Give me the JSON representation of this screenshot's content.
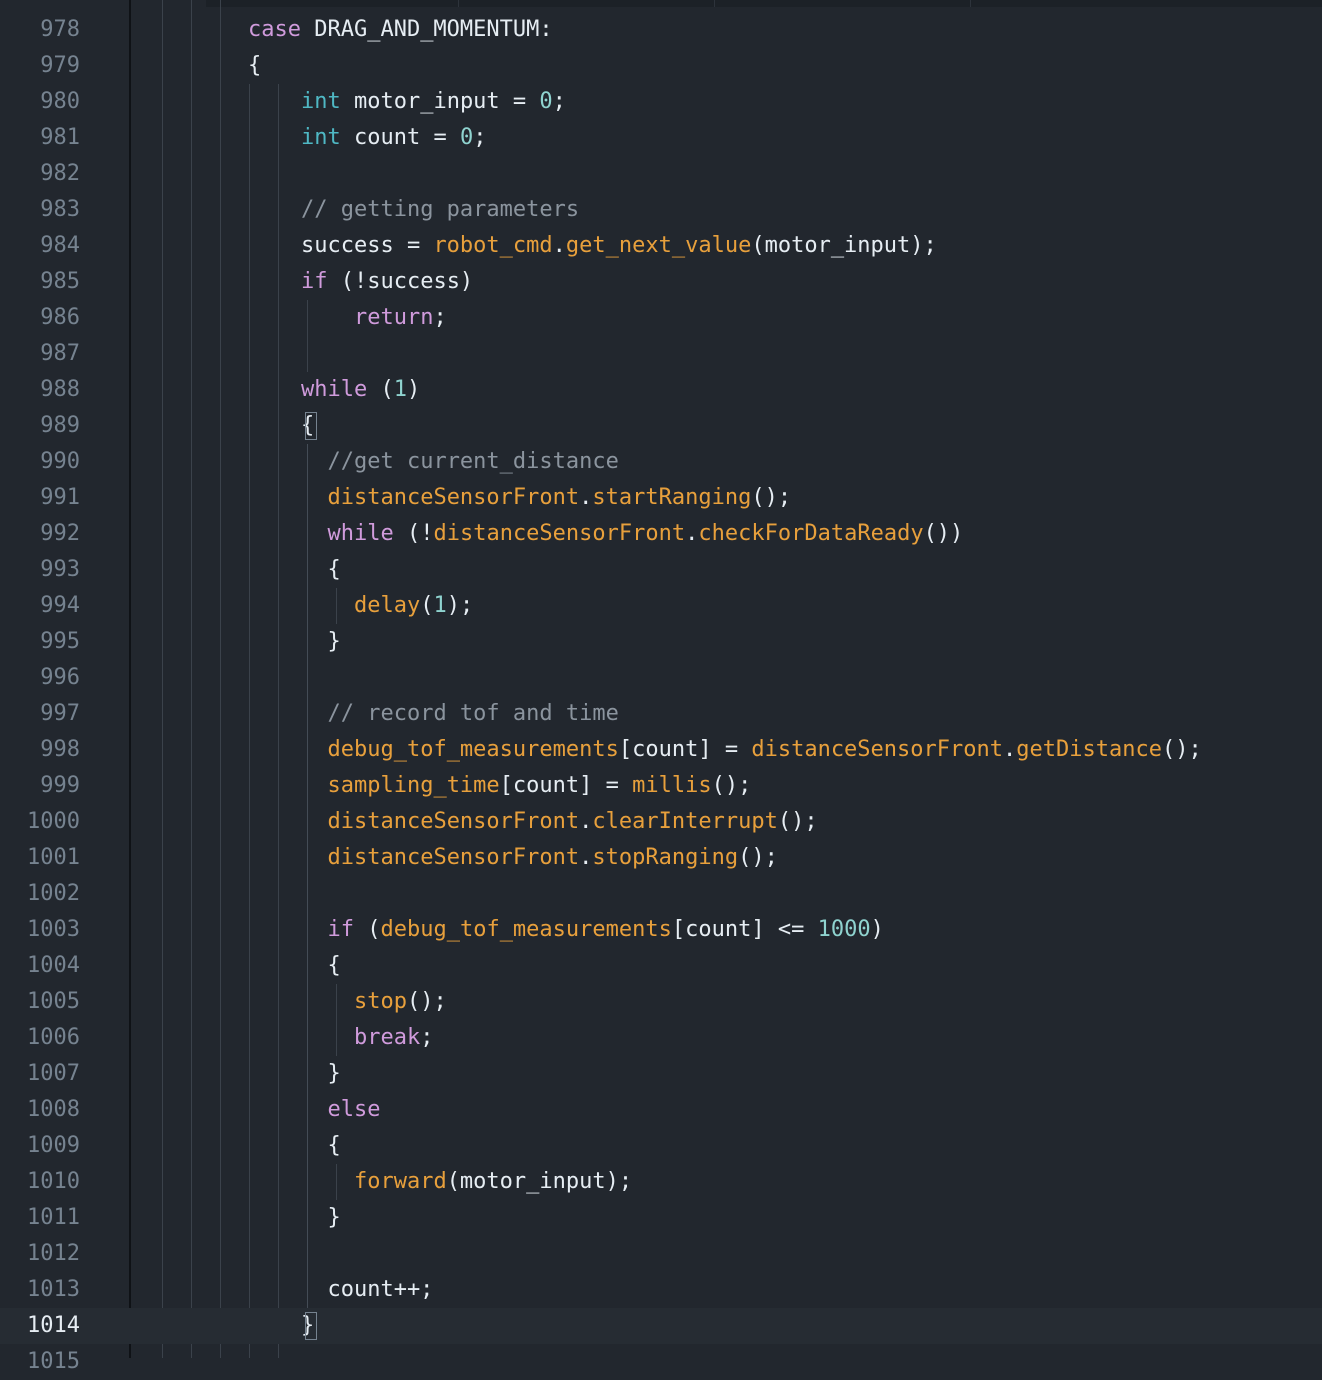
{
  "editor": {
    "current_line": "1014",
    "lines": [
      {
        "n": "978",
        "tokens": [
          [
            "kw",
            "case"
          ],
          [
            "pl",
            " DRAG_AND_MOMENTUM:"
          ]
        ]
      },
      {
        "n": "979",
        "tokens": [
          [
            "pl",
            "{"
          ]
        ]
      },
      {
        "n": "980",
        "tokens": [
          [
            "pl",
            "    "
          ],
          [
            "ty",
            "int"
          ],
          [
            "pl",
            " motor_input = "
          ],
          [
            "num",
            "0"
          ],
          [
            "pl",
            ";"
          ]
        ]
      },
      {
        "n": "981",
        "tokens": [
          [
            "pl",
            "    "
          ],
          [
            "ty",
            "int"
          ],
          [
            "pl",
            " count = "
          ],
          [
            "num",
            "0"
          ],
          [
            "pl",
            ";"
          ]
        ]
      },
      {
        "n": "982",
        "tokens": []
      },
      {
        "n": "983",
        "tokens": [
          [
            "pl",
            "    "
          ],
          [
            "cm",
            "// getting parameters"
          ]
        ]
      },
      {
        "n": "984",
        "tokens": [
          [
            "pl",
            "    success = "
          ],
          [
            "fn",
            "robot_cmd"
          ],
          [
            "pl",
            "."
          ],
          [
            "fn",
            "get_next_value"
          ],
          [
            "pl",
            "(motor_input);"
          ]
        ]
      },
      {
        "n": "985",
        "tokens": [
          [
            "pl",
            "    "
          ],
          [
            "kw",
            "if"
          ],
          [
            "pl",
            " (!success)"
          ]
        ]
      },
      {
        "n": "986",
        "tokens": [
          [
            "pl",
            "        "
          ],
          [
            "kw",
            "return"
          ],
          [
            "pl",
            ";"
          ]
        ]
      },
      {
        "n": "987",
        "tokens": []
      },
      {
        "n": "988",
        "tokens": [
          [
            "pl",
            "    "
          ],
          [
            "kw",
            "while"
          ],
          [
            "pl",
            " ("
          ],
          [
            "num",
            "1"
          ],
          [
            "pl",
            ")"
          ]
        ]
      },
      {
        "n": "989",
        "tokens": [
          [
            "pl",
            "    {"
          ]
        ]
      },
      {
        "n": "990",
        "tokens": [
          [
            "pl",
            "      "
          ],
          [
            "cm",
            "//get current_distance"
          ]
        ]
      },
      {
        "n": "991",
        "tokens": [
          [
            "pl",
            "      "
          ],
          [
            "fn",
            "distanceSensorFront"
          ],
          [
            "pl",
            "."
          ],
          [
            "fn",
            "startRanging"
          ],
          [
            "pl",
            "();"
          ]
        ]
      },
      {
        "n": "992",
        "tokens": [
          [
            "pl",
            "      "
          ],
          [
            "kw",
            "while"
          ],
          [
            "pl",
            " (!"
          ],
          [
            "fn",
            "distanceSensorFront"
          ],
          [
            "pl",
            "."
          ],
          [
            "fn",
            "checkForDataReady"
          ],
          [
            "pl",
            "())"
          ]
        ]
      },
      {
        "n": "993",
        "tokens": [
          [
            "pl",
            "      {"
          ]
        ]
      },
      {
        "n": "994",
        "tokens": [
          [
            "pl",
            "        "
          ],
          [
            "fn",
            "delay"
          ],
          [
            "pl",
            "("
          ],
          [
            "num",
            "1"
          ],
          [
            "pl",
            ");"
          ]
        ]
      },
      {
        "n": "995",
        "tokens": [
          [
            "pl",
            "      }"
          ]
        ]
      },
      {
        "n": "996",
        "tokens": []
      },
      {
        "n": "997",
        "tokens": [
          [
            "pl",
            "      "
          ],
          [
            "cm",
            "// record tof and time"
          ]
        ]
      },
      {
        "n": "998",
        "tokens": [
          [
            "pl",
            "      "
          ],
          [
            "fn",
            "debug_tof_measurements"
          ],
          [
            "pl",
            "[count] = "
          ],
          [
            "fn",
            "distanceSensorFront"
          ],
          [
            "pl",
            "."
          ],
          [
            "fn",
            "getDistance"
          ],
          [
            "pl",
            "();"
          ]
        ]
      },
      {
        "n": "999",
        "tokens": [
          [
            "pl",
            "      "
          ],
          [
            "fn",
            "sampling_time"
          ],
          [
            "pl",
            "[count] = "
          ],
          [
            "fn",
            "millis"
          ],
          [
            "pl",
            "();"
          ]
        ]
      },
      {
        "n": "1000",
        "tokens": [
          [
            "pl",
            "      "
          ],
          [
            "fn",
            "distanceSensorFront"
          ],
          [
            "pl",
            "."
          ],
          [
            "fn",
            "clearInterrupt"
          ],
          [
            "pl",
            "();"
          ]
        ]
      },
      {
        "n": "1001",
        "tokens": [
          [
            "pl",
            "      "
          ],
          [
            "fn",
            "distanceSensorFront"
          ],
          [
            "pl",
            "."
          ],
          [
            "fn",
            "stopRanging"
          ],
          [
            "pl",
            "();"
          ]
        ]
      },
      {
        "n": "1002",
        "tokens": []
      },
      {
        "n": "1003",
        "tokens": [
          [
            "pl",
            "      "
          ],
          [
            "kw",
            "if"
          ],
          [
            "pl",
            " ("
          ],
          [
            "fn",
            "debug_tof_measurements"
          ],
          [
            "pl",
            "[count] <= "
          ],
          [
            "num",
            "1000"
          ],
          [
            "pl",
            ")"
          ]
        ]
      },
      {
        "n": "1004",
        "tokens": [
          [
            "pl",
            "      {"
          ]
        ]
      },
      {
        "n": "1005",
        "tokens": [
          [
            "pl",
            "        "
          ],
          [
            "fn",
            "stop"
          ],
          [
            "pl",
            "();"
          ]
        ]
      },
      {
        "n": "1006",
        "tokens": [
          [
            "pl",
            "        "
          ],
          [
            "kw",
            "break"
          ],
          [
            "pl",
            ";"
          ]
        ]
      },
      {
        "n": "1007",
        "tokens": [
          [
            "pl",
            "      }"
          ]
        ]
      },
      {
        "n": "1008",
        "tokens": [
          [
            "pl",
            "      "
          ],
          [
            "kw",
            "else"
          ]
        ]
      },
      {
        "n": "1009",
        "tokens": [
          [
            "pl",
            "      {"
          ]
        ]
      },
      {
        "n": "1010",
        "tokens": [
          [
            "pl",
            "        "
          ],
          [
            "fn",
            "forward"
          ],
          [
            "pl",
            "(motor_input);"
          ]
        ]
      },
      {
        "n": "1011",
        "tokens": [
          [
            "pl",
            "      }"
          ]
        ]
      },
      {
        "n": "1012",
        "tokens": []
      },
      {
        "n": "1013",
        "tokens": [
          [
            "pl",
            "      count++;"
          ]
        ]
      },
      {
        "n": "1014",
        "tokens": [
          [
            "pl",
            "    }"
          ]
        ]
      },
      {
        "n": "1015",
        "tokens": []
      }
    ]
  },
  "colors": {
    "background": "#22272e",
    "keyword": "#d09bdc",
    "type": "#4fb8c4",
    "function": "#e8a03c",
    "number": "#8fd3cf",
    "comment": "#8b949e",
    "text": "#e6edf3",
    "line_number": "#768390",
    "current_line_number": "#e6edf3"
  }
}
